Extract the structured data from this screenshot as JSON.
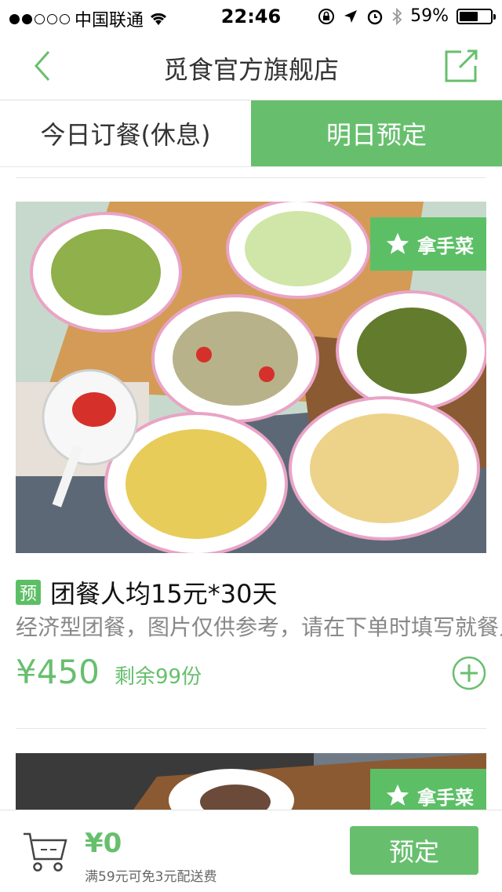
{
  "status_bar": {
    "carrier": "中国联通",
    "time": "22:46",
    "battery": "59%"
  },
  "nav": {
    "title": "觅食官方旗舰店"
  },
  "tabs": [
    {
      "label": "今日订餐(休息)",
      "active": false
    },
    {
      "label": "明日预定",
      "active": true
    }
  ],
  "items": [
    {
      "badge": "拿手菜",
      "tag": "预",
      "title": "团餐人均15元*30天",
      "description": "经济型团餐，图片仅供参考，请在下单时填写就餐人",
      "price": "¥450",
      "remaining": "剩余99份"
    },
    {
      "badge": "拿手菜"
    }
  ],
  "footer": {
    "total": "¥0",
    "delivery_note": "满59元可免3元配送费",
    "order_button": "预定"
  },
  "colors": {
    "accent": "#67bf6e",
    "badge": "#5cbf66"
  }
}
